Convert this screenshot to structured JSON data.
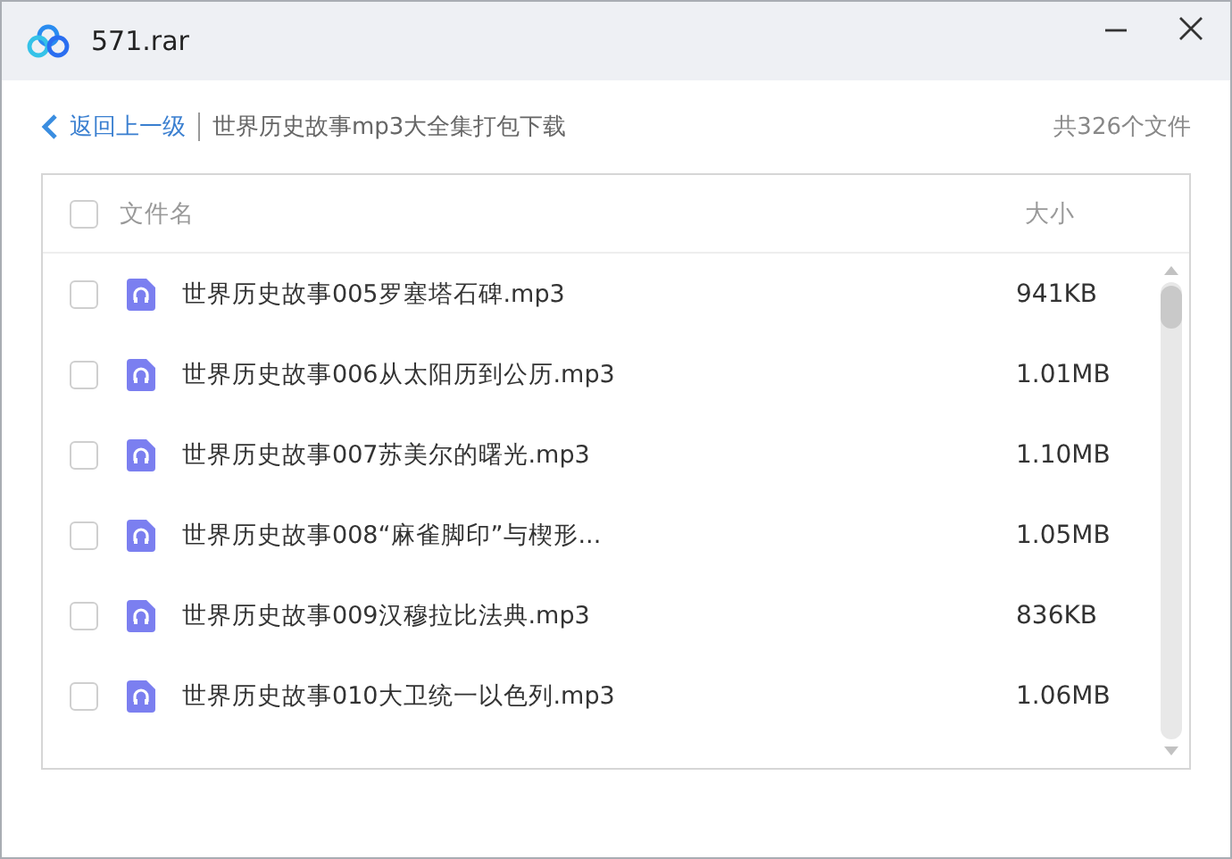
{
  "window": {
    "title": "571.rar"
  },
  "breadcrumb": {
    "back": "返回上一级",
    "path": "世界历史故事mp3大全集打包下载",
    "count": "共326个文件"
  },
  "table": {
    "header": {
      "checked": false,
      "columns": [
        "文件名",
        "大小"
      ]
    },
    "rows": [
      {
        "checked": false,
        "name": "世界历史故事005罗塞塔石碑.mp3",
        "size": "941KB"
      },
      {
        "checked": false,
        "name": "世界历史故事006从太阳历到公历.mp3",
        "size": "1.01MB"
      },
      {
        "checked": false,
        "name": "世界历史故事007苏美尔的曙光.mp3",
        "size": "1.10MB"
      },
      {
        "checked": false,
        "name": "世界历史故事008“麻雀脚印”与楔形...",
        "size": "1.05MB"
      },
      {
        "checked": false,
        "name": "世界历史故事009汉穆拉比法典.mp3",
        "size": "836KB"
      },
      {
        "checked": false,
        "name": "世界历史故事010大卫统一以色列.mp3",
        "size": "1.06MB"
      }
    ]
  }
}
